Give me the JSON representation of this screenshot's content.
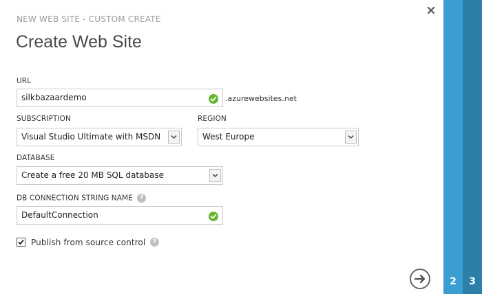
{
  "dialog": {
    "subtitle": "NEW WEB SITE - CUSTOM CREATE",
    "title": "Create Web Site"
  },
  "url": {
    "label": "URL",
    "value": "silkbazaardemo",
    "suffix": ".azurewebsites.net",
    "status_icon": "check-circle-icon"
  },
  "subscription": {
    "label": "SUBSCRIPTION",
    "selected": "Visual Studio Ultimate with MSDN"
  },
  "region": {
    "label": "REGION",
    "selected": "West Europe"
  },
  "database": {
    "label": "DATABASE",
    "selected": "Create a free 20 MB SQL database"
  },
  "db_connection": {
    "label": "DB CONNECTION STRING NAME",
    "help": "?",
    "value": "DefaultConnection",
    "status_icon": "check-circle-icon"
  },
  "publish": {
    "label": "Publish from source control",
    "checked": true,
    "help": "?"
  },
  "steps": [
    {
      "number": "2",
      "color": "#3a9fd0"
    },
    {
      "number": "3",
      "color": "#2b7fa8"
    }
  ],
  "colors": {
    "ok": "#67b531",
    "accent": "#3a9fd0"
  }
}
